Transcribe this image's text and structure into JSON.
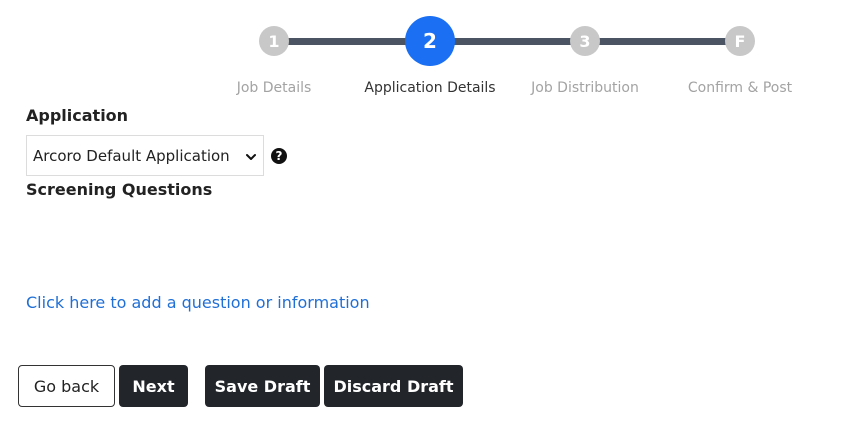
{
  "stepper": {
    "steps": [
      {
        "marker": "1",
        "label": "Job Details",
        "state": "inactive"
      },
      {
        "marker": "2",
        "label": "Application Details",
        "state": "active"
      },
      {
        "marker": "3",
        "label": "Job Distribution",
        "state": "inactive"
      },
      {
        "marker": "F",
        "label": "Confirm & Post",
        "state": "inactive"
      }
    ]
  },
  "form": {
    "application_label": "Application",
    "application_value": "Arcoro Default Application",
    "screening_label": "Screening Questions",
    "add_question_link": "Click here to add a question or information",
    "help_icon": "question-circle-icon"
  },
  "buttons": {
    "go_back": "Go back",
    "next": "Next",
    "save_draft": "Save Draft",
    "discard_draft": "Discard Draft"
  },
  "colors": {
    "accent": "#1a6ff2",
    "track": "#4a5462",
    "inactive_step": "#c8c8c8",
    "link": "#1f6fd6",
    "dark_button": "#22262b"
  }
}
